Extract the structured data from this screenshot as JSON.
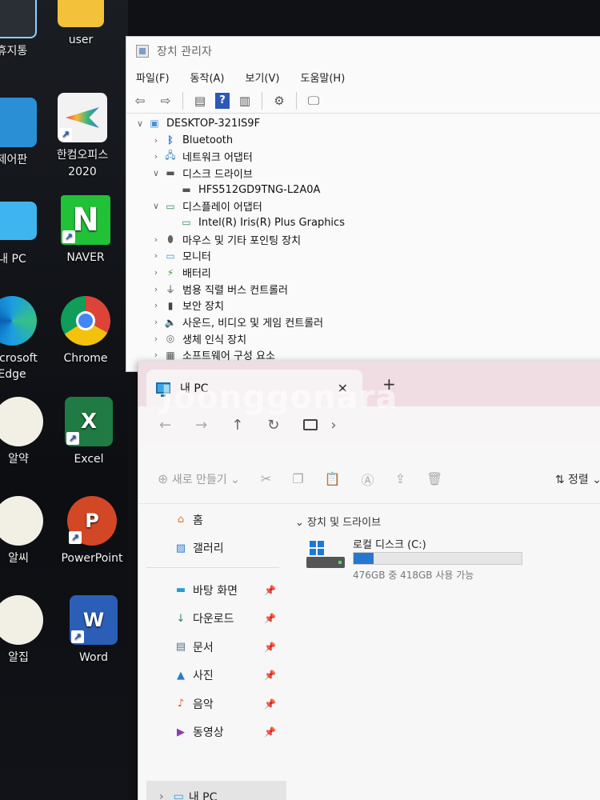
{
  "desktop": {
    "icons": [
      {
        "label": "휴지통"
      },
      {
        "label": "user"
      },
      {
        "label": "제어판"
      },
      {
        "label": "한컴오피스 2020"
      },
      {
        "label": "내 PC"
      },
      {
        "label": "NAVER"
      },
      {
        "label": "Microsoft Edge"
      },
      {
        "label": "Chrome"
      },
      {
        "label": "알약"
      },
      {
        "label": "Excel"
      },
      {
        "label": "알씨"
      },
      {
        "label": "PowerPoint"
      },
      {
        "label": "알집"
      },
      {
        "label": "Word"
      }
    ]
  },
  "device_manager": {
    "title": "장치 관리자",
    "menu": [
      "파일(F)",
      "동작(A)",
      "보기(V)",
      "도움말(H)"
    ],
    "root": "DESKTOP-321IS9F",
    "nodes": [
      {
        "label": "Bluetooth"
      },
      {
        "label": "네트워크 어댑터"
      },
      {
        "label": "디스크 드라이브"
      },
      {
        "label": "HFS512GD9TNG-L2A0A"
      },
      {
        "label": "디스플레이 어댑터"
      },
      {
        "label": "Intel(R) Iris(R) Plus Graphics"
      },
      {
        "label": "마우스 및 기타 포인팅 장치"
      },
      {
        "label": "모니터"
      },
      {
        "label": "배터리"
      },
      {
        "label": "범용 직렬 버스 컨트롤러"
      },
      {
        "label": "보안 장치"
      },
      {
        "label": "사운드, 비디오 및 게임 컨트롤러"
      },
      {
        "label": "생체 인식 장치"
      },
      {
        "label": "소프트웨어 구성 요소"
      }
    ]
  },
  "explorer": {
    "tab_title": "내 PC",
    "watermark": "Joonggonara",
    "new_label": "새로 만들기",
    "sort_label": "정렬",
    "sidebar": {
      "home": "홈",
      "gallery": "갤러리",
      "pinned": [
        "바탕 화면",
        "다운로드",
        "문서",
        "사진",
        "음악",
        "동영상"
      ],
      "this_pc": "내 PC"
    },
    "group_header": "장치 및 드라이브",
    "drive": {
      "name": "로컬 디스크 (C:)",
      "free_text": "476GB 중 418GB 사용 가능",
      "used_fraction": 0.12
    }
  }
}
